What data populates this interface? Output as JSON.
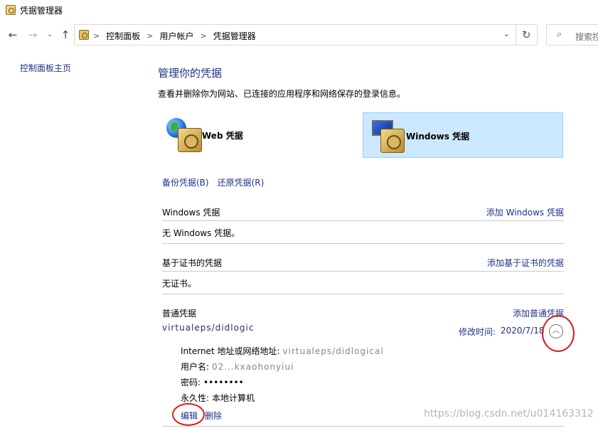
{
  "window": {
    "title": "凭据管理器",
    "icon": "credential-manager-icon"
  },
  "nav": {
    "back": "←",
    "forward": "→",
    "recent": "⌄",
    "up": "↑"
  },
  "address": {
    "crumbs": [
      "控制面板",
      "用户帐户",
      "凭据管理器"
    ],
    "separator": ">",
    "dropdown": "⌄",
    "refresh": "↻"
  },
  "search": {
    "placeholder": "搜索控",
    "icon": "search-icon"
  },
  "sidebar": {
    "home_link": "控制面板主页"
  },
  "main": {
    "heading": "管理你的凭据",
    "subtext": "查看并删除你为网站、已连接的应用程序和网络保存的登录信息。",
    "types": {
      "web_label": "Web 凭据",
      "windows_label": "Windows 凭据",
      "selected": "Windows 凭据",
      "selected_bg": "#cce8ff"
    },
    "backup_link": "备份凭据(B)",
    "restore_link": "还原凭据(R)",
    "sections": {
      "windows": {
        "name": "Windows 凭据",
        "action": "添加 Windows 凭据",
        "empty": "无 Windows 凭据。"
      },
      "cert": {
        "name": "基于证书的凭据",
        "action": "添加基于证书的凭据",
        "empty": "无证书。"
      },
      "generic": {
        "name": "普通凭据",
        "action": "添加普通凭据"
      }
    },
    "credential": {
      "name": "virtualeps/didlogical",
      "modified_label": "修改时间:",
      "modified_date": "2020/7/18",
      "details": {
        "address_label": "Internet 地址或网络地址:",
        "address_value": "virtualeps/didlogical",
        "user_label": "用户名:",
        "user_value": "02...kxaohonyiui",
        "password_label": "密码:",
        "password_value": "••••••••",
        "persist_label": "永久性:",
        "persist_value": "本地计算机"
      },
      "edit_link": "编辑",
      "delete_link": "删除"
    }
  },
  "annotation_color": "#e01818",
  "watermark": "https://blog.csdn.net/u014163312"
}
